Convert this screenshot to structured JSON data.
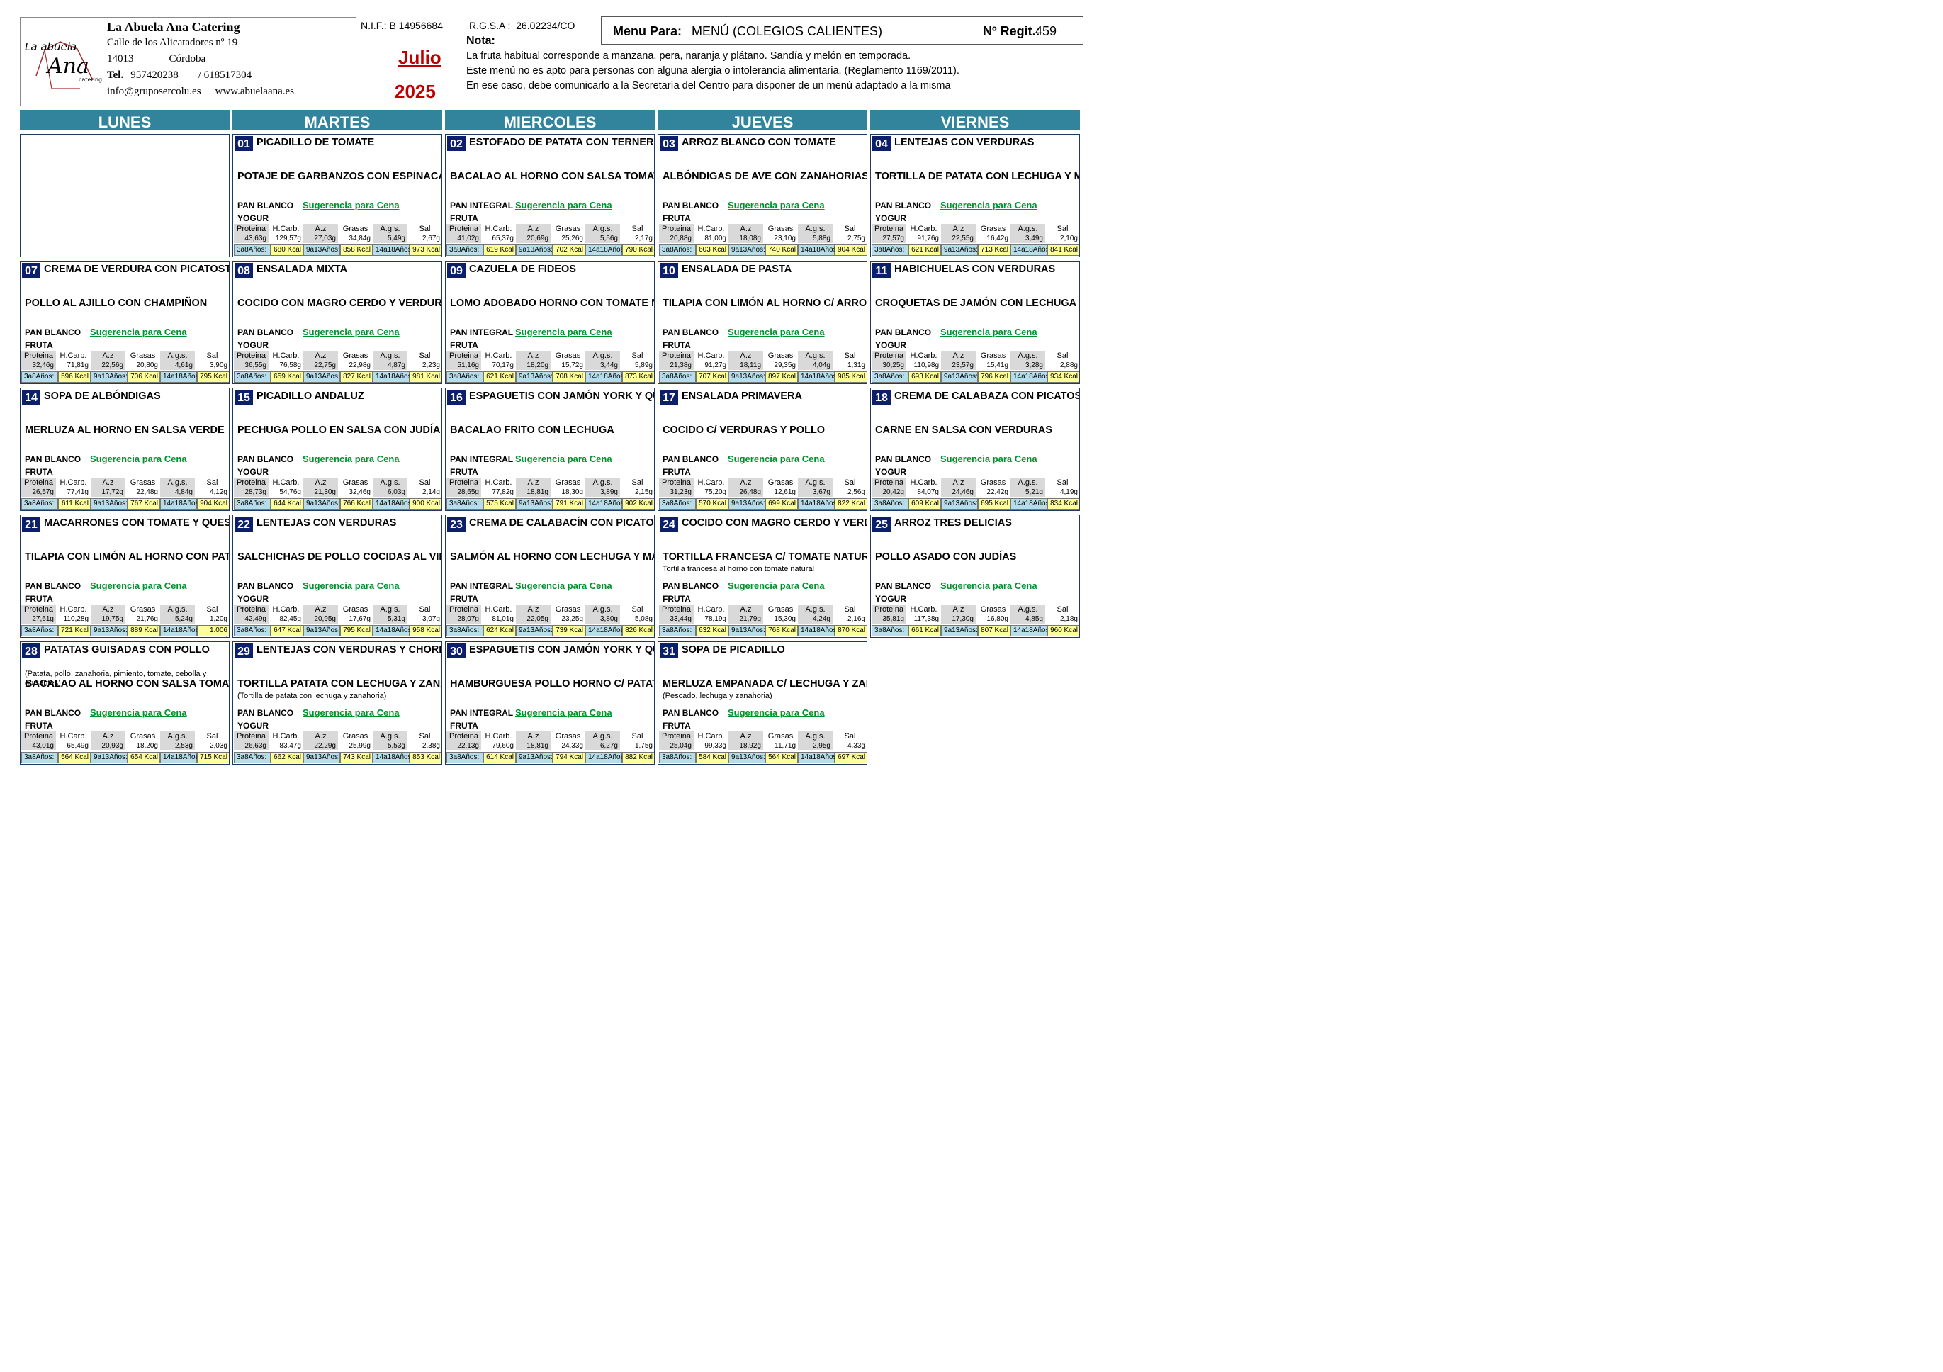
{
  "company": {
    "name": "La Abuela Ana Catering",
    "address": "Calle de los Alicatadores nº 19",
    "postal_code": "14013",
    "city": "Córdoba",
    "tel_label": "Tel.",
    "phone1": "957420238",
    "phone2": "/ 618517304",
    "email": "info@gruposercolu.es",
    "web": "www.abuelaana.es",
    "logo_text": {
      "line1": "La abuela",
      "line2": "Ana",
      "line3": "catering"
    }
  },
  "nif": "N.I.F.: B 14956684",
  "rgsa": "R.G.S.A :  26.02234/CO",
  "month": "Julio",
  "year": "2025",
  "nota": {
    "label": "Nota:",
    "lines": [
      "La fruta habitual corresponde a manzana, pera, naranja y plátano. Sandía y melón en temporada.",
      "Este menú no es apto para personas con alguna alergia o intolerancia alimentaria. (Reglamento 1169/2011).",
      "En ese caso, debe comunicarlo a la Secretaría del Centro para disponer de un menú adaptado a la misma"
    ]
  },
  "menu": {
    "label": "Menu Para:",
    "value": "MENÚ (COLEGIOS CALIENTES)",
    "reg_label": "Nº Regit.:",
    "reg_value": "459"
  },
  "weekdays": [
    "LUNES",
    "MARTES",
    "MIERCOLES",
    "JUEVES",
    "VIERNES"
  ],
  "nutrient_headers": [
    "Proteina",
    "H.Carb.",
    "A.z",
    "Grasas",
    "A.g.s.",
    "Sal"
  ],
  "kcal_labels": [
    "3a8Años:",
    "9a13Años:",
    "14a18Años:"
  ],
  "suggestion_label": "Sugerencia para Cena",
  "days": [
    {
      "num": "01",
      "dish1": "PICADILLO DE TOMATE",
      "dish2": "POTAJE DE GARBANZOS CON ESPINACAS",
      "bread": "PAN BLANCO",
      "dessert": "YOGUR",
      "nutrients": [
        "43,63g",
        "129,57g",
        "27,03g",
        "34,84g",
        "5,49g",
        "2,67g"
      ],
      "kcal": [
        "680 Kcal",
        "858 Kcal",
        "973 Kcal"
      ]
    },
    {
      "num": "02",
      "dish1": "ESTOFADO DE PATATA CON TERNERA",
      "dish2": "BACALAO AL HORNO CON SALSA TOMATE",
      "bread": "PAN INTEGRAL",
      "dessert": "FRUTA",
      "nutrients": [
        "41,02g",
        "65,37g",
        "20,69g",
        "25,26g",
        "5,56g",
        "2,17g"
      ],
      "kcal": [
        "619 Kcal",
        "702 Kcal",
        "790 Kcal"
      ]
    },
    {
      "num": "03",
      "dish1": "ARROZ BLANCO CON TOMATE",
      "dish2": "ALBÓNDIGAS DE AVE CON ZANAHORIAS",
      "bread": "PAN BLANCO",
      "dessert": "FRUTA",
      "nutrients": [
        "20,88g",
        "81,00g",
        "18,08g",
        "23,10g",
        "5,88g",
        "2,75g"
      ],
      "kcal": [
        "603 Kcal",
        "740 Kcal",
        "904 Kcal"
      ]
    },
    {
      "num": "04",
      "dish1": "LENTEJAS CON VERDURAS",
      "dish2": "TORTILLA DE PATATA CON LECHUGA Y MAÍZ",
      "bread": "PAN BLANCO",
      "dessert": "YOGUR",
      "nutrients": [
        "27,57g",
        "91,76g",
        "22,55g",
        "16,42g",
        "3,49g",
        "2,10g"
      ],
      "kcal": [
        "621 Kcal",
        "713 Kcal",
        "841 Kcal"
      ]
    },
    {
      "num": "07",
      "dish1": "CREMA DE VERDURA CON PICATOSTES",
      "dish2": "POLLO AL AJILLO CON CHAMPIÑON",
      "bread": "PAN BLANCO",
      "dessert": "FRUTA",
      "nutrients": [
        "32,46g",
        "71,81g",
        "22,56g",
        "20,80g",
        "4,61g",
        "3,90g"
      ],
      "kcal": [
        "596 Kcal",
        "706 Kcal",
        "795 Kcal"
      ]
    },
    {
      "num": "08",
      "dish1": "ENSALADA MIXTA",
      "dish2": "COCIDO CON MAGRO CERDO Y VERDURAS",
      "bread": "PAN BLANCO",
      "dessert": "YOGUR",
      "nutrients": [
        "36,55g",
        "76,58g",
        "22,75g",
        "22,98g",
        "4,87g",
        "2,23g"
      ],
      "kcal": [
        "659 Kcal",
        "827 Kcal",
        "981 Kcal"
      ]
    },
    {
      "num": "09",
      "dish1": "CAZUELA DE FIDEOS",
      "dish2": "LOMO ADOBADO HORNO CON TOMATE NATU",
      "bread": "PAN INTEGRAL",
      "dessert": "FRUTA",
      "nutrients": [
        "51,16g",
        "70,17g",
        "18,20g",
        "15,72g",
        "3,44g",
        "5,89g"
      ],
      "kcal": [
        "621 Kcal",
        "708 Kcal",
        "873 Kcal"
      ]
    },
    {
      "num": "10",
      "dish1": "ENSALADA DE PASTA",
      "dish2": "TILAPIA CON LIMÓN AL HORNO C/ ARROZ BLA",
      "bread": "PAN BLANCO",
      "dessert": "FRUTA",
      "nutrients": [
        "21,38g",
        "91,27g",
        "18,11g",
        "29,35g",
        "4,04g",
        "1,31g"
      ],
      "kcal": [
        "707 Kcal",
        "897 Kcal",
        "985 Kcal"
      ]
    },
    {
      "num": "11",
      "dish1": "HABICHUELAS CON VERDURAS",
      "dish2": "CROQUETAS DE JAMÓN CON LECHUGA",
      "bread": "PAN BLANCO",
      "dessert": "YOGUR",
      "nutrients": [
        "30,25g",
        "110,98g",
        "23,57g",
        "15,41g",
        "3,28g",
        "2,88g"
      ],
      "kcal": [
        "693 Kcal",
        "796 Kcal",
        "934 Kcal"
      ]
    },
    {
      "num": "14",
      "dish1": "SOPA DE ALBÓNDIGAS",
      "dish2": "MERLUZA AL HORNO EN SALSA VERDE",
      "bread": "PAN BLANCO",
      "dessert": "FRUTA",
      "nutrients": [
        "26,57g",
        "77,41g",
        "17,72g",
        "22,48g",
        "4,84g",
        "4,12g"
      ],
      "kcal": [
        "611 Kcal",
        "767 Kcal",
        "904 Kcal"
      ]
    },
    {
      "num": "15",
      "dish1": "PICADILLO ANDALUZ",
      "dish2": "PECHUGA POLLO EN SALSA CON JUDÍAS",
      "bread": "PAN BLANCO",
      "dessert": "YOGUR",
      "nutrients": [
        "28,73g",
        "54,76g",
        "21,30g",
        "32,46g",
        "6,03g",
        "2,14g"
      ],
      "kcal": [
        "644 Kcal",
        "766 Kcal",
        "900 Kcal"
      ]
    },
    {
      "num": "16",
      "dish1": "ESPAGUETIS CON JAMÓN YORK Y QUESO",
      "dish2": "BACALAO FRITO CON LECHUGA",
      "bread": "PAN INTEGRAL",
      "dessert": "FRUTA",
      "nutrients": [
        "28,65g",
        "77,82g",
        "18,81g",
        "18,30g",
        "3,89g",
        "2,15g"
      ],
      "kcal": [
        "575 Kcal",
        "791 Kcal",
        "902 Kcal"
      ]
    },
    {
      "num": "17",
      "dish1": "ENSALADA PRIMAVERA",
      "dish2": "COCIDO C/ VERDURAS  Y POLLO",
      "bread": "PAN BLANCO",
      "dessert": "FRUTA",
      "nutrients": [
        "31,23g",
        "75,20g",
        "26,48g",
        "12,61g",
        "3,67g",
        "2,56g"
      ],
      "kcal": [
        "570 Kcal",
        "699 Kcal",
        "822 Kcal"
      ]
    },
    {
      "num": "18",
      "dish1": "CREMA DE CALABAZA CON PICATOSTES",
      "dish2": "CARNE EN SALSA CON VERDURAS",
      "bread": "PAN BLANCO",
      "dessert": "YOGUR",
      "nutrients": [
        "20,42g",
        "84,07g",
        "24,46g",
        "22,42g",
        "5,21g",
        "4,19g"
      ],
      "kcal": [
        "609 Kcal",
        "695 Kcal",
        "834 Kcal"
      ]
    },
    {
      "num": "21",
      "dish1": "MACARRONES CON TOMATE Y QUESO",
      "dish2": "TILAPIA CON LIMÓN AL HORNO CON PATATA",
      "bread": "PAN BLANCO",
      "dessert": "FRUTA",
      "nutrients": [
        "27,61g",
        "110,28g",
        "19,75g",
        "21,76g",
        "5,24g",
        "1,20g"
      ],
      "kcal": [
        "721 Kcal",
        "889 Kcal",
        "1.006 Kcal"
      ]
    },
    {
      "num": "22",
      "dish1": "LENTEJAS CON VERDURAS",
      "dish2": "SALCHICHAS DE POLLO COCIDAS AL VINO C/",
      "bread": "PAN BLANCO",
      "dessert": "YOGUR",
      "nutrients": [
        "42,49g",
        "82,45g",
        "20,95g",
        "17,67g",
        "5,31g",
        "3,07g"
      ],
      "kcal": [
        "647 Kcal",
        "795 Kcal",
        "958 Kcal"
      ]
    },
    {
      "num": "23",
      "dish1": "CREMA DE CALABACÍN CON PICATOSTES",
      "dish2": "SALMÓN AL HORNO CON LECHUGA Y MAÍZ",
      "bread": "PAN INTEGRAL",
      "dessert": "FRUTA",
      "nutrients": [
        "28,07g",
        "81,01g",
        "22,05g",
        "23,25g",
        "3,80g",
        "5,08g"
      ],
      "kcal": [
        "624 Kcal",
        "739 Kcal",
        "826 Kcal"
      ]
    },
    {
      "num": "24",
      "dish1": "COCIDO CON MAGRO CERDO Y VERDURA",
      "dish2": "TORTILLA FRANCESA C/ TOMATE NATURAL",
      "desc2": "Tortilla francesa al horno con tomate natural",
      "bread": "PAN BLANCO",
      "dessert": "FRUTA",
      "nutrients": [
        "33,44g",
        "78,19g",
        "21,79g",
        "15,30g",
        "4,24g",
        "2,16g"
      ],
      "kcal": [
        "632 Kcal",
        "768 Kcal",
        "870 Kcal"
      ]
    },
    {
      "num": "25",
      "dish1": "ARROZ TRES DELICIAS",
      "dish2": "POLLO ASADO CON JUDÍAS",
      "bread": "PAN BLANCO",
      "dessert": "YOGUR",
      "nutrients": [
        "35,81g",
        "117,38g",
        "17,30g",
        "16,80g",
        "4,85g",
        "2,18g"
      ],
      "kcal": [
        "661 Kcal",
        "807 Kcal",
        "960 Kcal"
      ]
    },
    {
      "num": "28",
      "dish1": "PATATAS GUISADAS CON POLLO",
      "desc1": "(Patata, pollo, zanahoria, pimiento, tomate, cebolla y guisantes)",
      "dish2": "BACALAO AL HORNO CON SALSA TOMATE",
      "bread": "PAN BLANCO",
      "dessert": "FRUTA",
      "nutrients": [
        "43,01g",
        "65,49g",
        "20,93g",
        "18,20g",
        "2,53g",
        "2,03g"
      ],
      "kcal": [
        "564 Kcal",
        "654 Kcal",
        "715 Kcal"
      ]
    },
    {
      "num": "29",
      "dish1": "LENTEJAS CON VERDURAS Y CHORIZO",
      "dish2": "TORTILLA PATATA CON LECHUGA Y ZANAHO",
      "desc2": "(Tortilla de patata con lechuga y zanahoria)",
      "bread": "PAN BLANCO",
      "dessert": "YOGUR",
      "nutrients": [
        "26,63g",
        "83,47g",
        "22,29g",
        "25,99g",
        "5,53g",
        "2,38g"
      ],
      "kcal": [
        "662 Kcal",
        "743 Kcal",
        "853 Kcal"
      ]
    },
    {
      "num": "30",
      "dish1": "ESPAGUETIS CON JAMÓN YORK Y QUESO",
      "dish2": "HAMBURGUESA POLLO HORNO C/ PATATA C",
      "bread": "PAN INTEGRAL",
      "dessert": "FRUTA",
      "nutrients": [
        "22,13g",
        "79,60g",
        "18,81g",
        "24,33g",
        "6,27g",
        "1,75g"
      ],
      "kcal": [
        "614 Kcal",
        "794 Kcal",
        "882 Kcal"
      ]
    },
    {
      "num": "31",
      "dish1": "SOPA DE PICADILLO",
      "dish2": "MERLUZA EMPANADA C/ LECHUGA Y ZANAHO",
      "desc2": "(Pescado, lechuga y zanahoria)",
      "bread": "PAN BLANCO",
      "dessert": "FRUTA",
      "nutrients": [
        "25,04g",
        "99,33g",
        "18,92g",
        "11,71g",
        "2,95g",
        "4,33g"
      ],
      "kcal": [
        "584 Kcal",
        "564 Kcal",
        "697 Kcal"
      ]
    }
  ]
}
